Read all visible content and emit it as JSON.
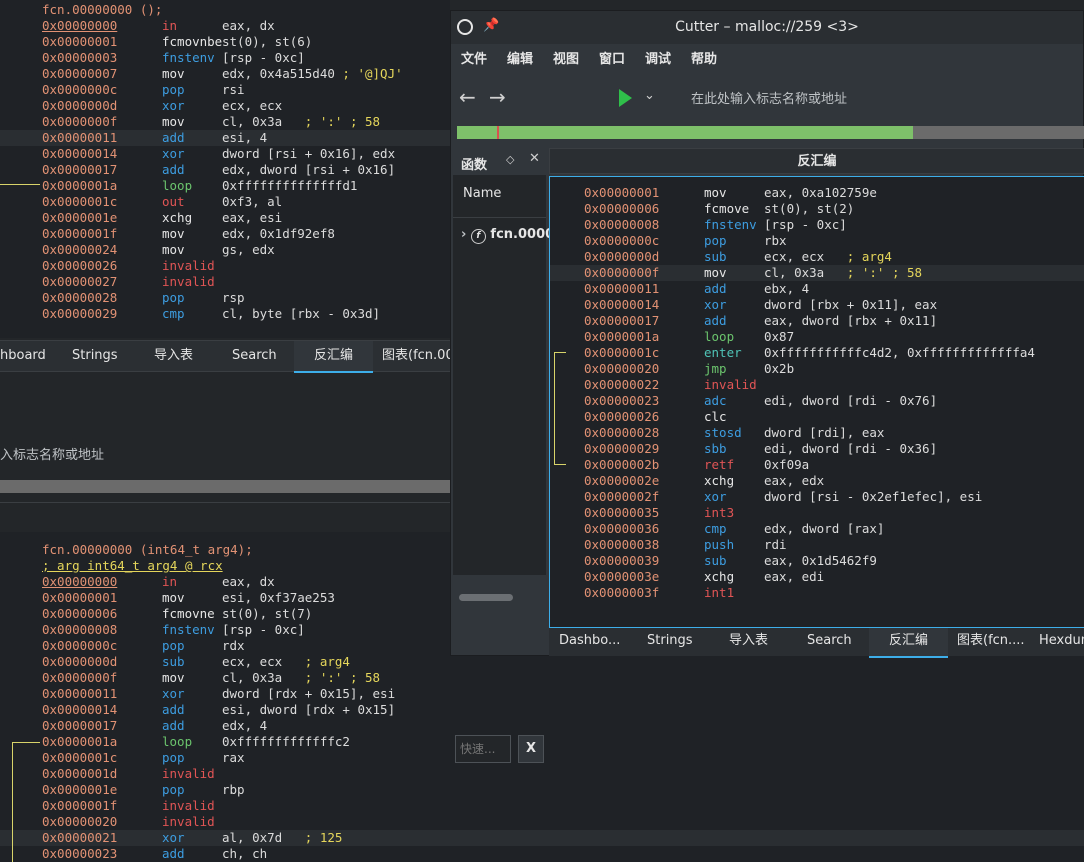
{
  "bg_top": {
    "header": "fcn.00000000 ();",
    "lines": [
      {
        "a": "0x00000000",
        "o": "in",
        "oc": "c-red",
        "g": "eax, dx",
        "u": true
      },
      {
        "a": "0x00000001",
        "o": "fcmovnbe",
        "oc": "c-white",
        "g": "st(0), st(6)"
      },
      {
        "a": "0x00000003",
        "o": "fnstenv",
        "oc": "c-blue",
        "g": "[rsp - 0xc]"
      },
      {
        "a": "0x00000007",
        "o": "mov",
        "oc": "c-white",
        "g": "edx, 0x4a515d40 ; '@]QJ'"
      },
      {
        "a": "0x0000000c",
        "o": "pop",
        "oc": "c-blue",
        "g": "rsi"
      },
      {
        "a": "0x0000000d",
        "o": "xor",
        "oc": "c-blue",
        "g": "ecx, ecx"
      },
      {
        "a": "0x0000000f",
        "o": "mov",
        "oc": "c-white",
        "g": "cl, 0x3a   ; ':' ; 58"
      },
      {
        "a": "0x00000011",
        "o": "add",
        "oc": "c-blue",
        "g": "esi, 4",
        "hl": true
      },
      {
        "a": "0x00000014",
        "o": "xor",
        "oc": "c-blue",
        "g": "dword [rsi + 0x16], edx"
      },
      {
        "a": "0x00000017",
        "o": "add",
        "oc": "c-blue",
        "g": "edx, dword [rsi + 0x16]"
      },
      {
        "a": "0x0000001a",
        "o": "loop",
        "oc": "c-green",
        "g": "0xffffffffffffffd1"
      },
      {
        "a": "0x0000001c",
        "o": "out",
        "oc": "c-red",
        "g": "0xf3, al"
      },
      {
        "a": "0x0000001e",
        "o": "xchg",
        "oc": "c-white",
        "g": "eax, esi"
      },
      {
        "a": "0x0000001f",
        "o": "mov",
        "oc": "c-white",
        "g": "edx, 0x1df92ef8"
      },
      {
        "a": "0x00000024",
        "o": "mov",
        "oc": "c-white",
        "g": "gs, edx"
      },
      {
        "a": "0x00000026",
        "o": "invalid",
        "oc": "c-red",
        "g": ""
      },
      {
        "a": "0x00000027",
        "o": "invalid",
        "oc": "c-red",
        "g": ""
      },
      {
        "a": "0x00000028",
        "o": "pop",
        "oc": "c-blue",
        "g": "rsp"
      },
      {
        "a": "0x00000029",
        "o": "cmp",
        "oc": "c-blue",
        "g": "cl, byte [rbx - 0x3d]"
      }
    ]
  },
  "bg_tabs": [
    "hboard",
    "Strings",
    "导入表",
    "Search",
    "反汇编",
    "图表(fcn.00"
  ],
  "bg_search_placeholder": "入标志名称或地址",
  "bg_bottom": {
    "header1": "fcn.00000000 (int64_t arg4);",
    "header2": "; arg int64_t arg4 @ rcx",
    "lines": [
      {
        "a": "0x00000000",
        "o": "in",
        "oc": "c-red",
        "g": "eax, dx",
        "u": true
      },
      {
        "a": "0x00000001",
        "o": "mov",
        "oc": "c-white",
        "g": "esi, 0xf37ae253"
      },
      {
        "a": "0x00000006",
        "o": "fcmovne",
        "oc": "c-white",
        "g": "st(0), st(7)"
      },
      {
        "a": "0x00000008",
        "o": "fnstenv",
        "oc": "c-blue",
        "g": "[rsp - 0xc]"
      },
      {
        "a": "0x0000000c",
        "o": "pop",
        "oc": "c-blue",
        "g": "rdx"
      },
      {
        "a": "0x0000000d",
        "o": "sub",
        "oc": "c-blue",
        "g": "ecx, ecx   ; arg4"
      },
      {
        "a": "0x0000000f",
        "o": "mov",
        "oc": "c-white",
        "g": "cl, 0x3a   ; ':' ; 58"
      },
      {
        "a": "0x00000011",
        "o": "xor",
        "oc": "c-blue",
        "g": "dword [rdx + 0x15], esi"
      },
      {
        "a": "0x00000014",
        "o": "add",
        "oc": "c-blue",
        "g": "esi, dword [rdx + 0x15]"
      },
      {
        "a": "0x00000017",
        "o": "add",
        "oc": "c-blue",
        "g": "edx, 4"
      },
      {
        "a": "0x0000001a",
        "o": "loop",
        "oc": "c-green",
        "g": "0xfffffffffffffc2"
      },
      {
        "a": "0x0000001c",
        "o": "pop",
        "oc": "c-blue",
        "g": "rax"
      },
      {
        "a": "0x0000001d",
        "o": "invalid",
        "oc": "c-red",
        "g": ""
      },
      {
        "a": "0x0000001e",
        "o": "pop",
        "oc": "c-blue",
        "g": "rbp"
      },
      {
        "a": "0x0000001f",
        "o": "invalid",
        "oc": "c-red",
        "g": ""
      },
      {
        "a": "0x00000020",
        "o": "invalid",
        "oc": "c-red",
        "g": ""
      },
      {
        "a": "0x00000021",
        "o": "xor",
        "oc": "c-blue",
        "g": "al, 0x7d   ; 125",
        "hl": true
      },
      {
        "a": "0x00000023",
        "o": "add",
        "oc": "c-blue",
        "g": "ch, ch"
      }
    ]
  },
  "cutter": {
    "title": "Cutter – malloc://259 <3>",
    "menus": [
      "文件",
      "编辑",
      "视图",
      "窗口",
      "调试",
      "帮助"
    ],
    "goto_placeholder": "在此处输入标志名称或地址",
    "progress_fraction": 0.726,
    "functions": {
      "title": "函数",
      "column": "Name",
      "item": "fcn.0000",
      "filter_placeholder": "快速...",
      "clear_label": "X"
    },
    "disasm_title": "反汇编",
    "lines": [
      {
        "a": "0x00000001",
        "o": "mov",
        "oc": "c-white",
        "g": "eax, 0xa102759e"
      },
      {
        "a": "0x00000006",
        "o": "fcmove",
        "oc": "c-white",
        "g": "st(0), st(2)"
      },
      {
        "a": "0x00000008",
        "o": "fnstenv",
        "oc": "c-blue",
        "g": "[rsp - 0xc]"
      },
      {
        "a": "0x0000000c",
        "o": "pop",
        "oc": "c-blue",
        "g": "rbx"
      },
      {
        "a": "0x0000000d",
        "o": "sub",
        "oc": "c-blue",
        "g": "ecx, ecx   ; arg4"
      },
      {
        "a": "0x0000000f",
        "o": "mov",
        "oc": "c-white",
        "g": "cl, 0x3a   ; ':' ; 58",
        "hl": true
      },
      {
        "a": "0x00000011",
        "o": "add",
        "oc": "c-blue",
        "g": "ebx, 4"
      },
      {
        "a": "0x00000014",
        "o": "xor",
        "oc": "c-blue",
        "g": "dword [rbx + 0x11], eax"
      },
      {
        "a": "0x00000017",
        "o": "add",
        "oc": "c-blue",
        "g": "eax, dword [rbx + 0x11]"
      },
      {
        "a": "0x0000001a",
        "o": "loop",
        "oc": "c-green",
        "g": "0x87"
      },
      {
        "a": "0x0000001c",
        "o": "enter",
        "oc": "c-teal",
        "g": "0xfffffffffffc4d2, 0xfffffffffffffa4"
      },
      {
        "a": "0x00000020",
        "o": "jmp",
        "oc": "c-green",
        "g": "0x2b"
      },
      {
        "a": "0x00000022",
        "o": "invalid",
        "oc": "c-red",
        "g": ""
      },
      {
        "a": "0x00000023",
        "o": "adc",
        "oc": "c-blue",
        "g": "edi, dword [rdi - 0x76]"
      },
      {
        "a": "0x00000026",
        "o": "clc",
        "oc": "c-white",
        "g": ""
      },
      {
        "a": "0x00000028",
        "o": "stosd",
        "oc": "c-blue",
        "g": "dword [rdi], eax"
      },
      {
        "a": "0x00000029",
        "o": "sbb",
        "oc": "c-blue",
        "g": "edi, dword [rdi - 0x36]"
      },
      {
        "a": "0x0000002b",
        "o": "retf",
        "oc": "c-red",
        "g": "0xf09a"
      },
      {
        "a": "0x0000002e",
        "o": "xchg",
        "oc": "c-white",
        "g": "eax, edx"
      },
      {
        "a": "0x0000002f",
        "o": "xor",
        "oc": "c-blue",
        "g": "dword [rsi - 0x2ef1efec], esi"
      },
      {
        "a": "0x00000035",
        "o": "int3",
        "oc": "c-red",
        "g": ""
      },
      {
        "a": "0x00000036",
        "o": "cmp",
        "oc": "c-blue",
        "g": "edx, dword [rax]"
      },
      {
        "a": "0x00000038",
        "o": "push",
        "oc": "c-blue",
        "g": "rdi"
      },
      {
        "a": "0x00000039",
        "o": "sub",
        "oc": "c-blue",
        "g": "eax, 0x1d5462f9"
      },
      {
        "a": "0x0000003e",
        "o": "xchg",
        "oc": "c-white",
        "g": "eax, edi"
      },
      {
        "a": "0x0000003f",
        "o": "int1",
        "oc": "c-red",
        "g": ""
      }
    ],
    "tabs": [
      "Dashbo...",
      "Strings",
      "导入表",
      "Search",
      "反汇编",
      "图表(fcn....",
      "Hexdum"
    ]
  }
}
